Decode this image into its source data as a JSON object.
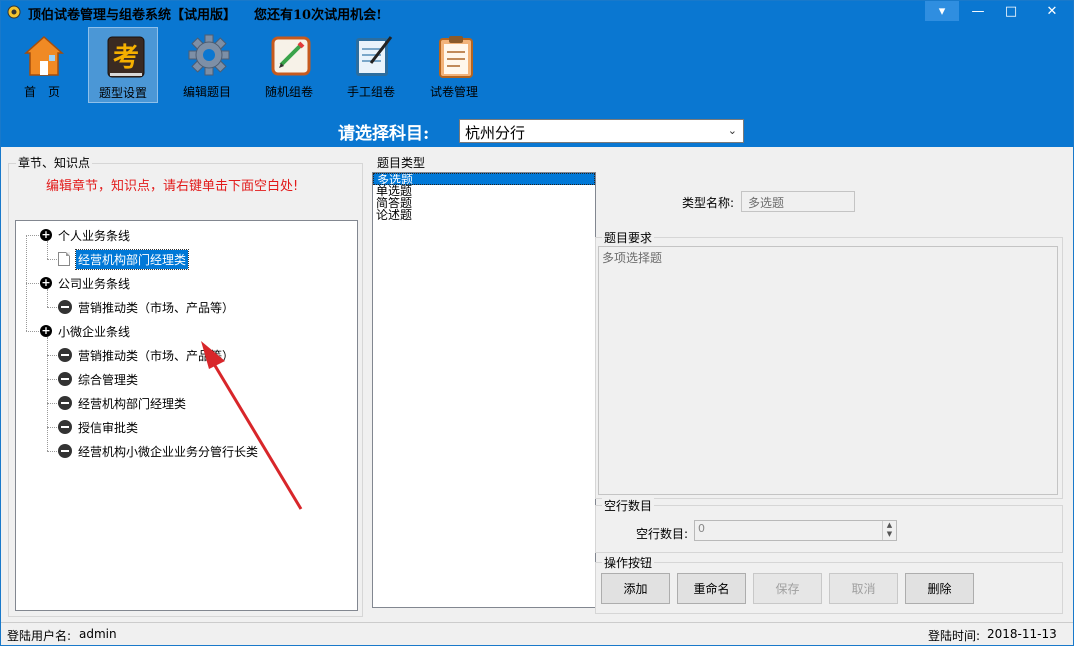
{
  "window": {
    "title": "顶伯试卷管理与组卷系统【试用版】",
    "trial_notice": "您还有10次试用机会!",
    "controls": [
      "▾",
      "—",
      "□",
      "✕"
    ]
  },
  "toolbar": {
    "items": [
      {
        "label": "首　页",
        "icon": "house-icon"
      },
      {
        "label": "题型设置",
        "icon": "exam-book-icon",
        "active": true
      },
      {
        "label": "编辑题目",
        "icon": "gear-icon"
      },
      {
        "label": "随机组卷",
        "icon": "pencil-board-icon"
      },
      {
        "label": "手工组卷",
        "icon": "notepad-pen-icon"
      },
      {
        "label": "试卷管理",
        "icon": "clipboard-icon"
      }
    ]
  },
  "subject": {
    "label": "请选择科目:",
    "value": "杭州分行"
  },
  "chapters": {
    "group_label": "章节、知识点",
    "hint": "编辑章节，知识点，请右键单击下面空白处!",
    "tree": [
      {
        "label": "个人业务条线",
        "children": [
          {
            "label": "经营机构部门经理类",
            "selected": true
          }
        ]
      },
      {
        "label": "公司业务条线",
        "children": [
          {
            "label": "营销推动类（市场、产品等）"
          }
        ]
      },
      {
        "label": "小微企业条线",
        "children": [
          {
            "label": "营销推动类（市场、产品等）"
          },
          {
            "label": "综合管理类"
          },
          {
            "label": "经营机构部门经理类"
          },
          {
            "label": "授信审批类"
          },
          {
            "label": "经营机构小微企业业务分管行长类"
          }
        ]
      }
    ]
  },
  "question_types": {
    "group_label": "题目类型",
    "items": [
      "多选题",
      "单选题",
      "简答题",
      "论述题"
    ],
    "selected_index": 0
  },
  "detail": {
    "type_name_label": "类型名称:",
    "type_name_value": "多选题",
    "requirement_group": "题目要求",
    "requirement_text": "多项选择题",
    "blank_group": "空行数目",
    "blank_label": "空行数目:",
    "blank_value": "0",
    "actions_group": "操作按钮",
    "buttons": [
      {
        "label": "添加",
        "enabled": true
      },
      {
        "label": "重命名",
        "enabled": true
      },
      {
        "label": "保存",
        "enabled": false
      },
      {
        "label": "取消",
        "enabled": false
      },
      {
        "label": "删除",
        "enabled": true
      }
    ]
  },
  "status": {
    "user_label": "登陆用户名:",
    "user": "admin",
    "time_label": "登陆时间:",
    "time": "2018-11-13"
  },
  "colors": {
    "header_bg": "#0a77d1",
    "hint_red": "#e21b1b",
    "selection": "#0078d7"
  }
}
